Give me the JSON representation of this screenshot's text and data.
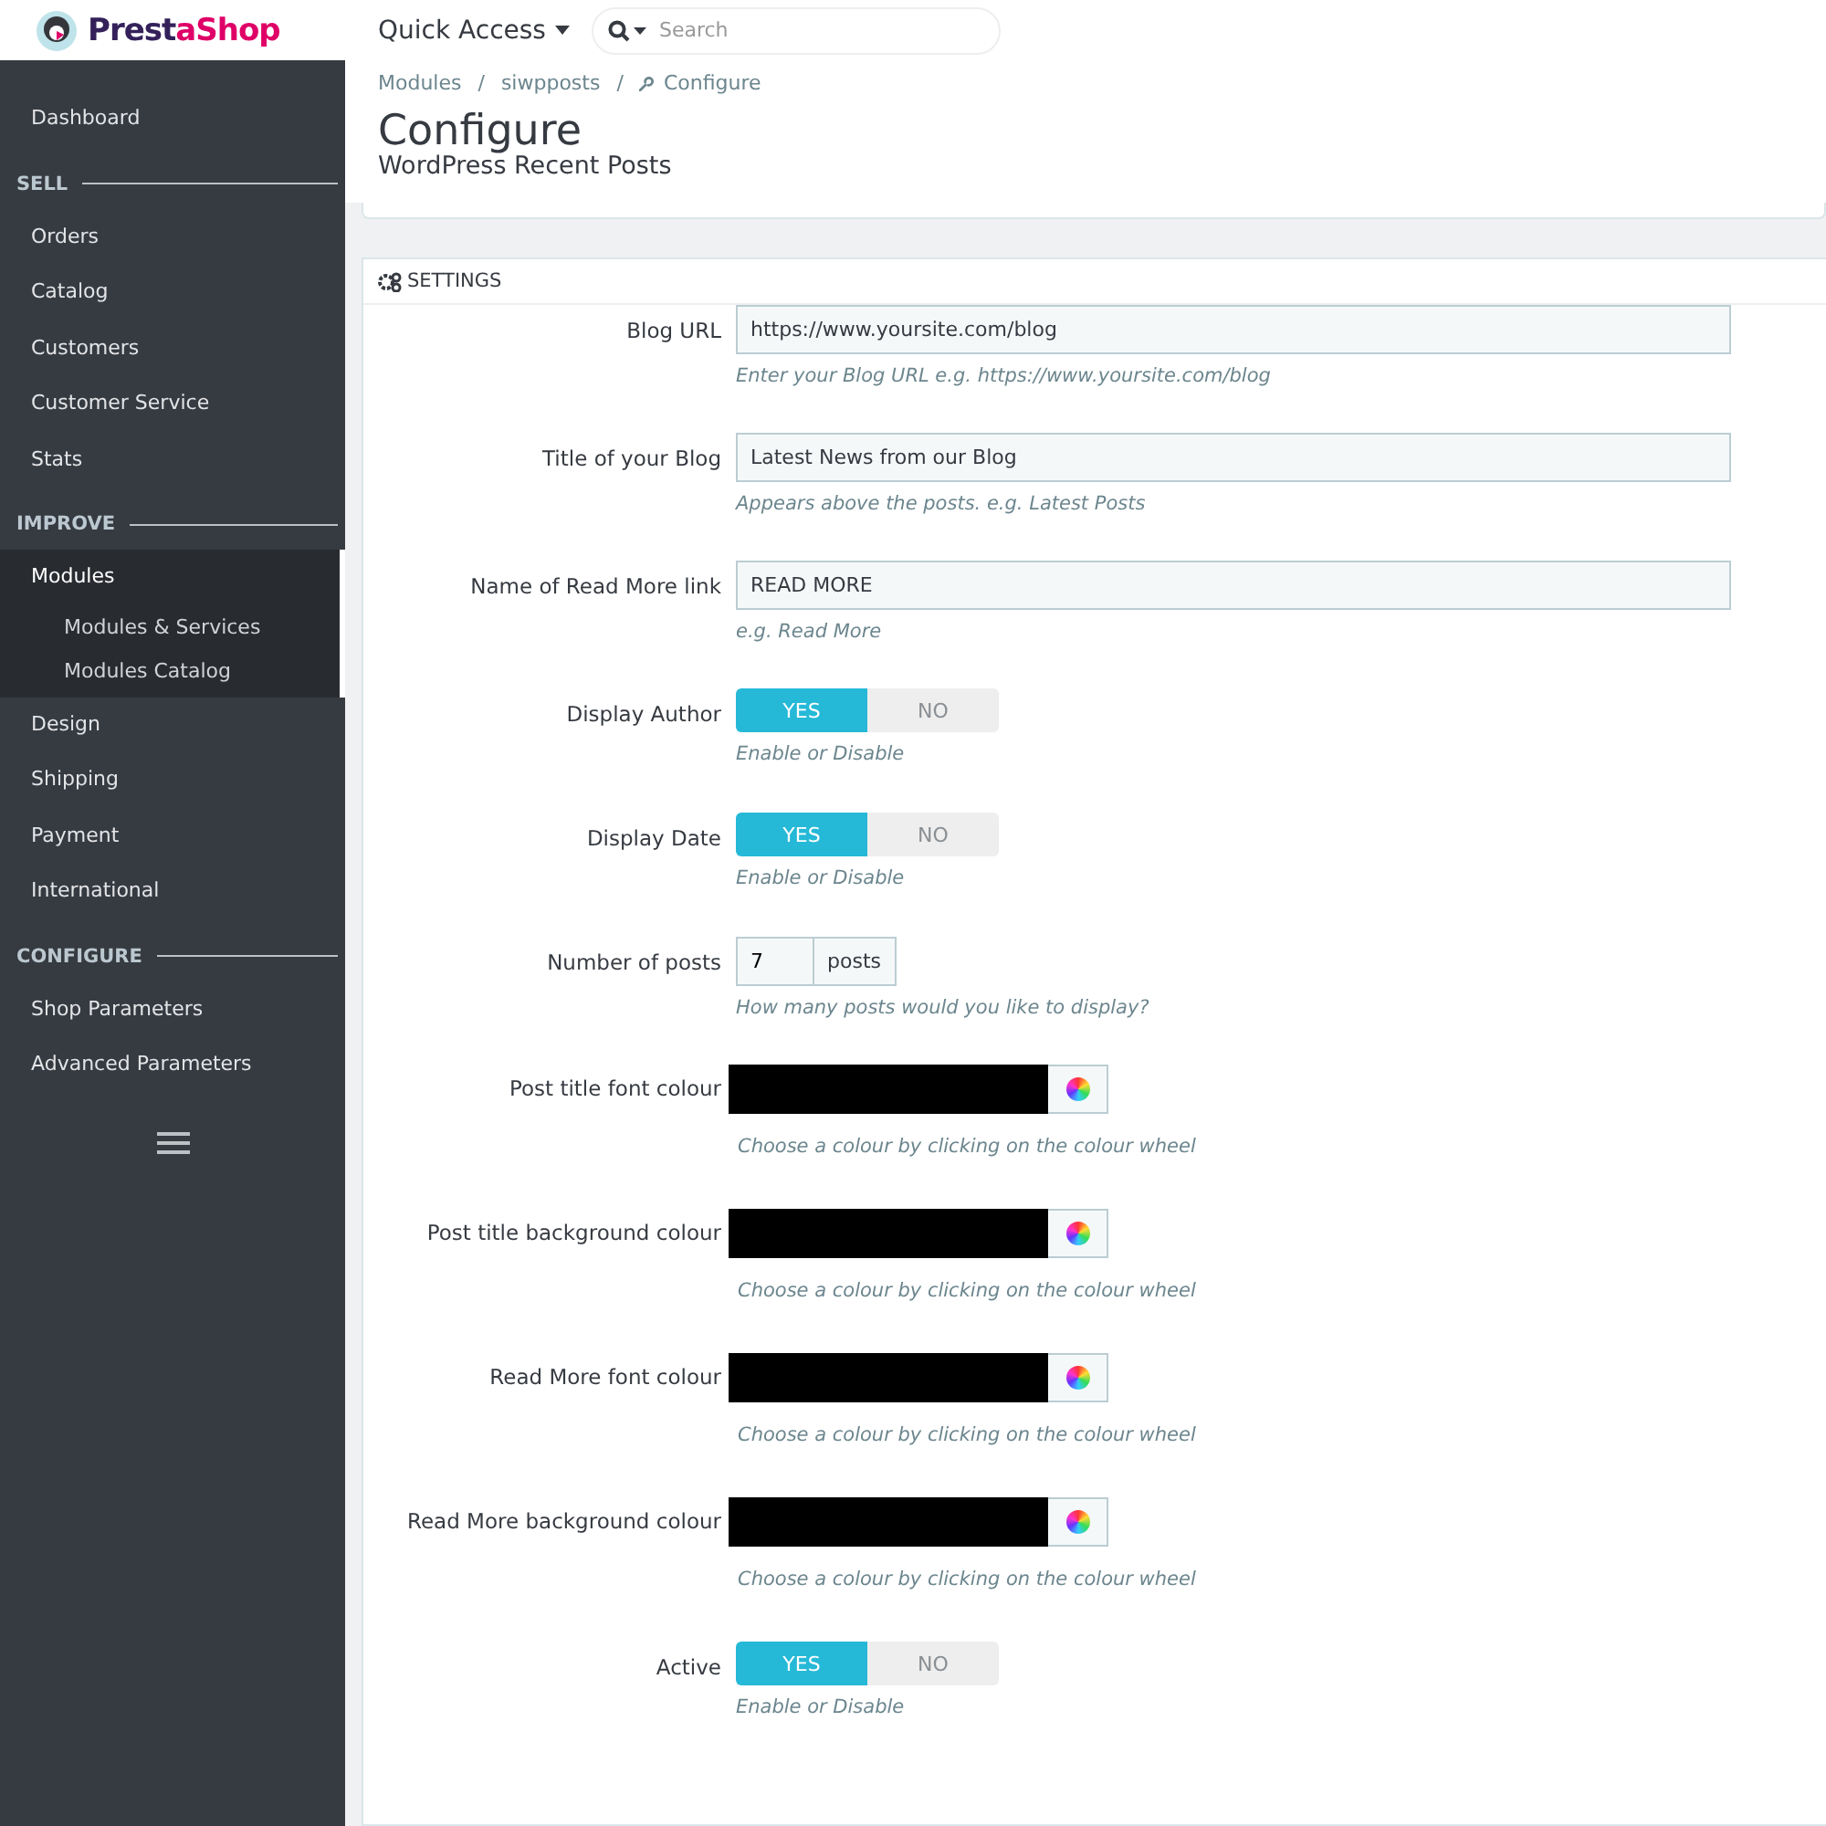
{
  "header": {
    "logo": "PrestaShop",
    "quick_access": "Quick Access",
    "search": {
      "placeholder": "Search"
    }
  },
  "sidebar": {
    "sections": [
      {
        "items": [
          {
            "label": "Dashboard",
            "selected": false
          }
        ]
      },
      {
        "heading": "SELL",
        "items": [
          {
            "label": "Orders",
            "selected": false
          },
          {
            "label": "Catalog",
            "selected": false
          },
          {
            "label": "Customers",
            "selected": false
          },
          {
            "label": "Customer Service",
            "selected": false
          },
          {
            "label": "Stats",
            "selected": false
          }
        ]
      },
      {
        "heading": "IMPROVE",
        "items": [
          {
            "label": "Modules",
            "selected": true,
            "children": [
              {
                "label": "Modules & Services"
              },
              {
                "label": "Modules Catalog"
              }
            ]
          },
          {
            "label": "Design",
            "selected": false
          },
          {
            "label": "Shipping",
            "selected": false
          },
          {
            "label": "Payment",
            "selected": false
          },
          {
            "label": "International",
            "selected": false
          }
        ]
      },
      {
        "heading": "CONFIGURE",
        "items": [
          {
            "label": "Shop Parameters",
            "selected": false
          },
          {
            "label": "Advanced Parameters",
            "selected": false
          }
        ]
      }
    ]
  },
  "breadcrumb": [
    {
      "label": "Modules"
    },
    {
      "separator": "/",
      "label": "siwpposts"
    },
    {
      "separator": "/",
      "label": "Configure"
    }
  ],
  "page": {
    "title": "Configure",
    "subtitle": "WordPress Recent Posts"
  },
  "panel": {
    "title": "SETTINGS",
    "fields": [
      {
        "kind": "text",
        "label": "Blog URL",
        "value": "https://www.yoursite.com/blog",
        "help": "Enter your Blog URL e.g. https://www.yoursite.com/blog"
      },
      {
        "kind": "text",
        "label": "Title of your Blog",
        "value": "Latest News from our Blog",
        "help": "Appears above the posts. e.g. Latest Posts"
      },
      {
        "kind": "text",
        "label": "Name of Read More link",
        "value": "READ MORE",
        "help": "e.g. Read More"
      },
      {
        "kind": "switch",
        "label": "Display Author",
        "on": true,
        "yes": "YES",
        "no": "NO",
        "help": "Enable or Disable"
      },
      {
        "kind": "switch",
        "label": "Display Date",
        "on": true,
        "yes": "YES",
        "no": "NO",
        "help": "Enable or Disable"
      },
      {
        "kind": "number",
        "label": "Number of posts",
        "value": "7",
        "suffix": "posts",
        "help": "How many posts would you like to display?"
      },
      {
        "kind": "color",
        "label": "Post title font colour",
        "color": "#000000",
        "help": "Choose a colour by clicking on the colour wheel"
      },
      {
        "kind": "color",
        "label": "Post title background colour",
        "color": "#000000",
        "help": "Choose a colour by clicking on the colour wheel"
      },
      {
        "kind": "color",
        "label": "Read More font colour",
        "color": "#000000",
        "help": "Choose a colour by clicking on the colour wheel"
      },
      {
        "kind": "color",
        "label": "Read More background colour",
        "color": "#000000",
        "help": "Choose a colour by clicking on the colour wheel"
      },
      {
        "kind": "switch",
        "label": "Active",
        "on": true,
        "yes": "YES",
        "no": "NO",
        "help": "Enable or Disable"
      }
    ]
  }
}
